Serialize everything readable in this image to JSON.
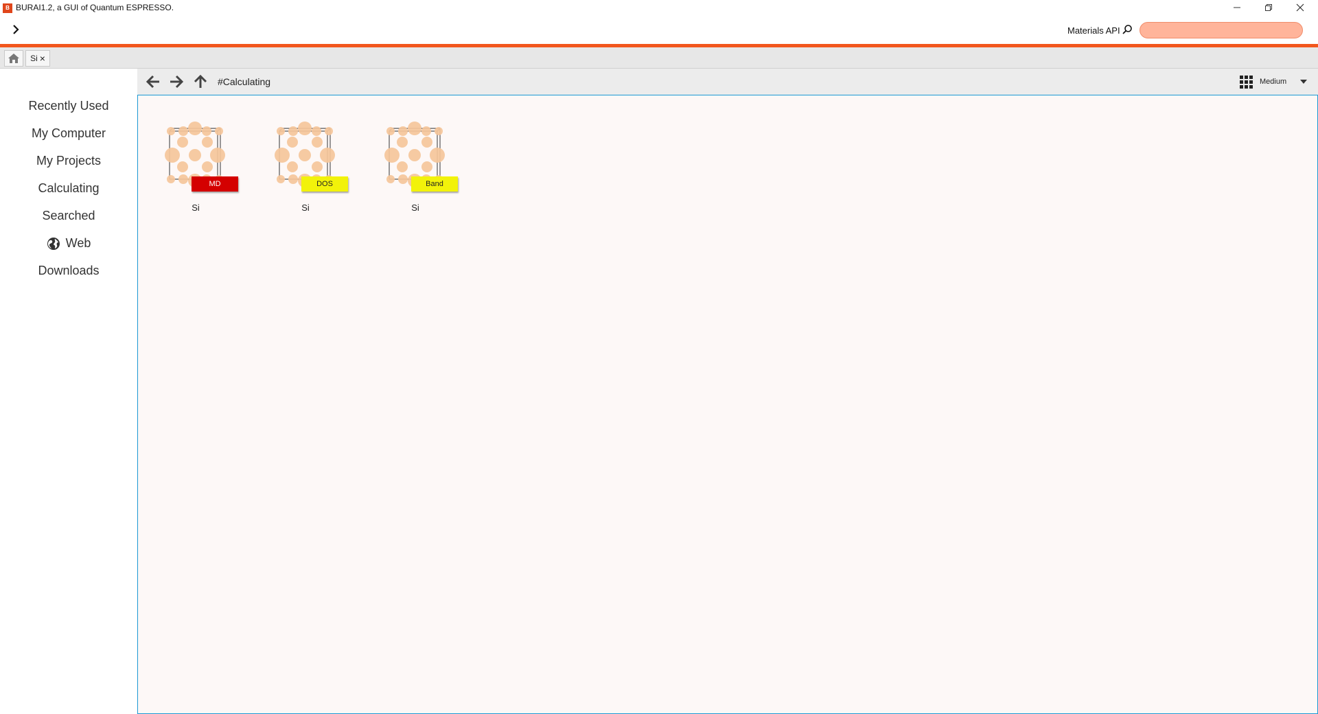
{
  "window": {
    "icon_text": "B",
    "title": "BURAI1.2, a GUI of Quantum ESPRESSO."
  },
  "toolbar": {
    "api_label": "Materials API",
    "api_search_value": "",
    "icons": {
      "expand": "chevron-right-icon",
      "search": "search-icon"
    }
  },
  "tabs": [
    {
      "label": "",
      "icon": "home-icon"
    },
    {
      "label": "Si",
      "close": "×"
    }
  ],
  "sidebar": {
    "items": [
      {
        "label": "Recently Used"
      },
      {
        "label": "My Computer"
      },
      {
        "label": "My Projects"
      },
      {
        "label": "Calculating"
      },
      {
        "label": "Searched"
      },
      {
        "label": "Web",
        "icon": "globe-icon"
      },
      {
        "label": "Downloads"
      }
    ]
  },
  "navbar": {
    "path": "#Calculating",
    "view_size": "Medium",
    "icons": [
      "back-arrow-icon",
      "forward-arrow-icon",
      "up-arrow-icon",
      "grid-view-icon",
      "dropdown-arrow-icon"
    ]
  },
  "files": [
    {
      "name": "Si",
      "badge": "MD",
      "badge_color": "#d40000",
      "badge_text_color": "#ffffff"
    },
    {
      "name": "Si",
      "badge": "DOS",
      "badge_color": "#f2f20a",
      "badge_text_color": "#222222"
    },
    {
      "name": "Si",
      "badge": "Band",
      "badge_color": "#f2f20a",
      "badge_text_color": "#222222"
    }
  ],
  "colors": {
    "accent": "#f2561d",
    "content_border": "#1a98d4",
    "atom": "#f5c59a"
  }
}
